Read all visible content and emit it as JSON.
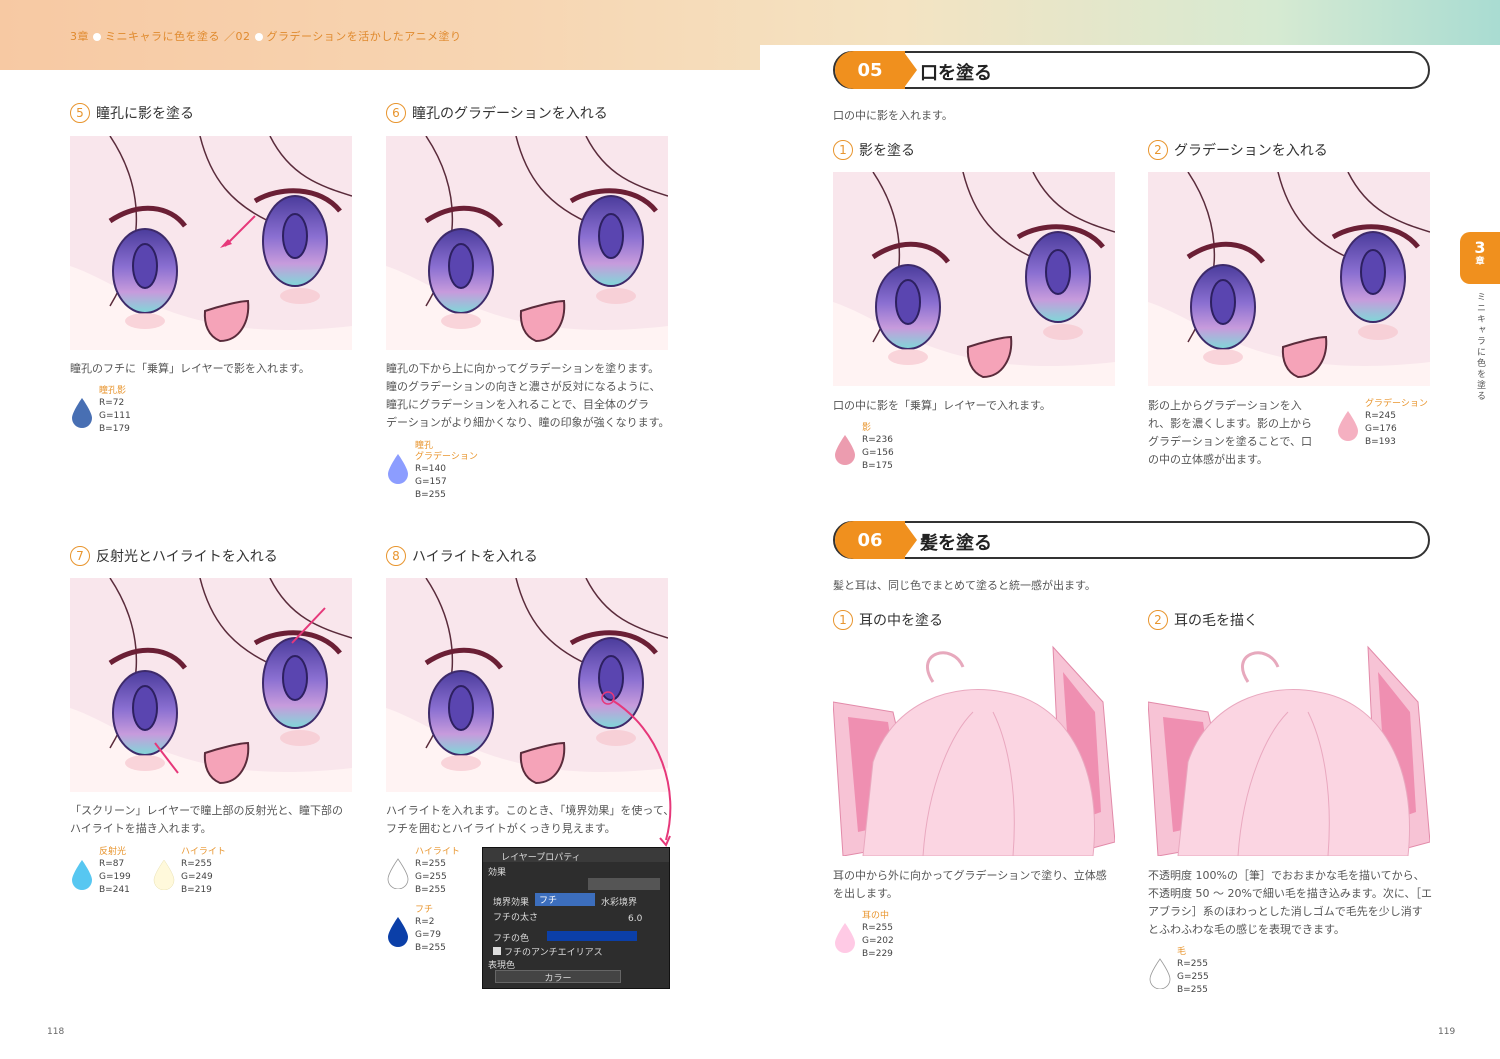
{
  "header": {
    "chapter": "3章",
    "title1": "ミニキャラに色を塗る",
    "sep": "02",
    "title2": "グラデーションを活かしたアニメ塗り"
  },
  "left": {
    "steps": [
      {
        "num": "5",
        "title": "瞳孔に影を塗る",
        "caption": "瞳孔のフチに「乗算」レイヤーで影を入れます。",
        "swatches": [
          {
            "label": "瞳孔影",
            "r": "R=72",
            "g": "G=111",
            "b": "B=179",
            "color": "#486fb3"
          }
        ]
      },
      {
        "num": "6",
        "title": "瞳孔のグラデーションを入れる",
        "caption_lines": [
          "瞳孔の下から上に向かってグラデーションを塗ります。",
          "瞳のグラデーションの向きと濃さが反対になるように、",
          "瞳孔にグラデーションを入れることで、目全体のグラ",
          "デーションがより細かくなり、瞳の印象が強くなります。"
        ],
        "swatches": [
          {
            "label1": "瞳孔",
            "label2": "グラデーション",
            "r": "R=140",
            "g": "G=157",
            "b": "B=255",
            "color": "#8c9dff"
          }
        ]
      },
      {
        "num": "7",
        "title": "反射光とハイライトを入れる",
        "caption_lines": [
          "「スクリーン」レイヤーで瞳上部の反射光と、瞳下部の",
          "ハイライトを描き入れます。"
        ],
        "swatches": [
          {
            "label": "反射光",
            "r": "R=87",
            "g": "G=199",
            "b": "B=241",
            "color": "#57c7f1"
          },
          {
            "label": "ハイライト",
            "r": "R=255",
            "g": "G=249",
            "b": "B=219",
            "color": "#fff9db"
          }
        ]
      },
      {
        "num": "8",
        "title": "ハイライトを入れる",
        "caption_lines": [
          "ハイライトを入れます。このとき、「境界効果」を使って、",
          "フチを囲むとハイライトがくっきり見えます。"
        ],
        "swatches": [
          {
            "label": "ハイライト",
            "r": "R=255",
            "g": "G=255",
            "b": "B=255",
            "color": "#ffffff"
          },
          {
            "label": "フチ",
            "r": "R=2",
            "g": "G=79",
            "b": "B=255",
            "color": "#024fff"
          }
        ]
      }
    ],
    "page": "118"
  },
  "dialog": {
    "title": "レイヤープロパティ",
    "effect": "効果",
    "border_effect": "境界効果",
    "fuchi": "フチ",
    "watercolor": "水彩境界",
    "thickness": "フチの太さ",
    "thickness_val": "6.0",
    "color_label": "フチの色",
    "antialias": "フチのアンチエイリアス",
    "expression": "表現色",
    "color_mode": "カラー"
  },
  "right": {
    "sections": [
      {
        "num": "05",
        "name": "口を塗る",
        "desc": "口の中に影を入れます。",
        "steps": [
          {
            "num": "1",
            "title": "影を塗る",
            "caption": "口の中に影を「乗算」レイヤーで入れます。",
            "swatch": {
              "label": "影",
              "r": "R=236",
              "g": "G=156",
              "b": "B=175",
              "color": "#ec9caf"
            }
          },
          {
            "num": "2",
            "title": "グラデーションを入れる",
            "caption_lines": [
              "影の上からグラデーションを入",
              "れ、影を濃くします。影の上から",
              "グラデーションを塗ることで、口",
              "の中の立体感が出ます。"
            ],
            "swatch": {
              "label": "グラデーション",
              "r": "R=245",
              "g": "G=176",
              "b": "B=193",
              "color": "#f5b0c1"
            }
          }
        ]
      },
      {
        "num": "06",
        "name": "髪を塗る",
        "desc": "髪と耳は、同じ色でまとめて塗ると統一感が出ます。",
        "steps": [
          {
            "num": "1",
            "title": "耳の中を塗る",
            "caption_lines": [
              "耳の中から外に向かってグラデーションで塗り、立体感",
              "を出します。"
            ],
            "swatch": {
              "label": "耳の中",
              "r": "R=255",
              "g": "G=202",
              "b": "B=229",
              "color": "#ffcae5"
            }
          },
          {
            "num": "2",
            "title": "耳の毛を描く",
            "caption_lines": [
              "不透明度 100%の［筆］でおおまかな毛を描いてから、",
              "不透明度 50 ～ 20%で細い毛を描き込みます。次に、［エ",
              "アブラシ］系のほわっとした消しゴムで毛先を少し消す",
              "とふわふわな毛の感じを表現できます。"
            ],
            "swatch": {
              "label": "毛",
              "r": "R=255",
              "g": "G=255",
              "b": "B=255",
              "color": "#ffffff"
            }
          }
        ]
      }
    ],
    "chapter_tab": {
      "num": "3",
      "label": "章",
      "vertical": "ミニキャラに色を塗る"
    },
    "page": "119"
  }
}
